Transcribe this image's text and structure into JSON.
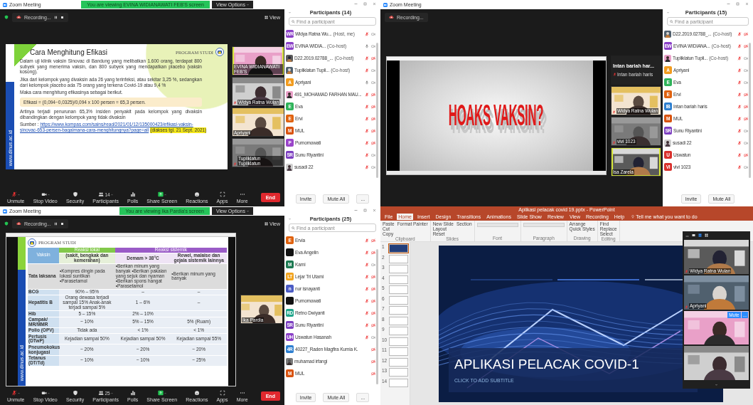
{
  "quadrants": [
    {
      "kind": "zoom",
      "window_title": "Zoom Meeting",
      "banner": "You are viewing EVINA WIDIANAWATI FEB'S screen",
      "view_options": "View Options",
      "recording": "Recording...",
      "record_controls": true,
      "view_button": "View",
      "shared": {
        "kind": "text_slide",
        "title": "Cara Menghitung Efikasi",
        "logo": "PROGRAM STUDI",
        "side_text": "www.dinus.ac.id",
        "paragraphs": [
          "Dalam uji klinik vaksin Sinovac di Bandung yang melibatkan 1.600 orang, terdapat 800 subyek yang menerima vaksin, dan 800 subyek yang mendapatkan placebo (vaksin kosong).",
          "Jika dari kelompok yang divaksin ada 26 yang terinfeksi, atau sekitar 3,25 %, sedangkan dari kelompok placebo ada 75 orang yang terkena Covid-19 atau 9,4 %",
          "Maka cara menghitung efikasinya sebagai berikut."
        ],
        "formula": "Efikasi = (0,094−0,0325)/0,094 x 100 persen = 65,3 persen.",
        "conclusion": "Artinya terjadi penurunan 65,3% insiden penyakit pada kelompok yang divaksin dibandingkan dengan kelompok yang tidak divaksin",
        "source": {
          "label": "Sumber :",
          "url_lines": [
            "https://www.kompas.com/sains/read/2021/01/12/135000423/efikasi-vaksin-",
            "sinovac-653-persen-bagaimana-cara-menghitungnya?page=all"
          ],
          "accessed": "(diakses tgl. 21 Sept. 2021)"
        }
      },
      "gallery": [
        {
          "kind": "video",
          "name": "EVINA WIDIANAWATI FEB'S",
          "muted": false,
          "speaking": true
        },
        {
          "kind": "video",
          "name": "Widya Ratna Wulan",
          "muted": true,
          "speaking": false
        },
        {
          "kind": "video",
          "name": "Apriyani",
          "muted": false,
          "speaking": false
        },
        {
          "kind": "video",
          "name": "Tupliklatun Tupliklatun",
          "muted": true,
          "speaking": false
        }
      ],
      "toolbar": [
        {
          "kind": "mic",
          "label": "Unmute",
          "caret": true
        },
        {
          "kind": "camera",
          "label": "Stop Video",
          "caret": true
        },
        {
          "kind": "security",
          "label": "Security",
          "caret": false
        },
        {
          "kind": "participants",
          "label": "Participants",
          "caret": true,
          "count": "14"
        },
        {
          "kind": "polls",
          "label": "Polls",
          "caret": false
        },
        {
          "kind": "share",
          "label": "Share Screen",
          "caret": true
        },
        {
          "kind": "reactions",
          "label": "Reactions",
          "caret": false
        },
        {
          "kind": "apps",
          "label": "Apps",
          "caret": false
        },
        {
          "kind": "more",
          "label": "More",
          "caret": false
        }
      ],
      "end_button": "End",
      "participants": {
        "title": "Participants (14)",
        "placeholder": "Find a participant",
        "buttons": [
          "Invite",
          "Mute All",
          "..."
        ],
        "rows": [
          {
            "kind": "initials",
            "initials": "WR",
            "color": "#8a3fc7",
            "name": "Widya Ratna Wu...",
            "role": "(Host, me)",
            "muted": true,
            "video_off": false
          },
          {
            "kind": "initials",
            "initials": "EW",
            "color": "#8a3fc7",
            "name": "EVINA WIDIA...",
            "role": "(Co-host)",
            "muted": false,
            "video_off": false
          },
          {
            "name": "D22.2019.02788_...",
            "role": "(Co-host)",
            "muted": true,
            "video_off": true
          },
          {
            "name": "Tupliklatun Tupli...",
            "role": "(Co-host)",
            "muted": true,
            "video_off": false
          },
          {
            "kind": "initials",
            "initials": "A",
            "color": "#f29c1f",
            "name": "Apriyani",
            "muted": false,
            "video_off": false
          },
          {
            "name": "491_MOHAMAD FARHAN MAU...",
            "muted": true,
            "video_off": true
          },
          {
            "kind": "initials",
            "initials": "E",
            "color": "#2fb35a",
            "name": "Eva",
            "muted": true,
            "video_off": true
          },
          {
            "kind": "initials",
            "initials": "E",
            "color": "#e0620f",
            "name": "Ervi",
            "muted": true,
            "video_off": true
          },
          {
            "kind": "initials",
            "initials": "M",
            "color": "#d9530f",
            "name": "MUL",
            "muted": true,
            "video_off": true
          },
          {
            "kind": "initials",
            "initials": "P",
            "color": "#9a45c9",
            "name": "Purnomowati",
            "muted": true,
            "video_off": true
          },
          {
            "kind": "initials",
            "initials": "SR",
            "color": "#7c3fc0",
            "name": "Sunu Riyantini",
            "muted": true,
            "video_off": false
          },
          {
            "name": "susadi 22",
            "muted": true,
            "video_off": false
          }
        ]
      }
    },
    {
      "kind": "zoom",
      "window_title": "Zoom Meeting",
      "recording": "Recording...",
      "record_controls": false,
      "shared": {
        "kind": "video_player",
        "heading": "HOAKS VAKSIN?"
      },
      "gallery": [
        {
          "kind": "name",
          "display": "Intan bariah har...",
          "name": "Intan bariah haris",
          "muted": true,
          "speaking": false
        },
        {
          "kind": "video",
          "name": "Widya Ratna Wulan",
          "muted": true,
          "speaking": false
        },
        {
          "kind": "video",
          "name": "vivi 1023",
          "muted": true,
          "speaking": false
        },
        {
          "kind": "video",
          "name": "Isa Zarela",
          "muted": false,
          "speaking": true
        }
      ],
      "participants": {
        "title": "Participants (15)",
        "placeholder": "Find a participant",
        "buttons": [
          "Invite",
          "Mute All"
        ],
        "rows": [
          {
            "name": "D22.2019.02788_...",
            "role": "(Co-host)",
            "muted": true,
            "video_off": true
          },
          {
            "kind": "initials",
            "initials": "EW",
            "color": "#8a3fc7",
            "name": "EVINA WIDIANA...",
            "role": "(Co-host)",
            "muted": true,
            "video_off": true
          },
          {
            "name": "Tupliklatun Tupli...",
            "role": "(Co-host)",
            "muted": true,
            "video_off": false
          },
          {
            "kind": "initials",
            "initials": "A",
            "color": "#f29c1f",
            "name": "Apriyani",
            "muted": true,
            "video_off": false
          },
          {
            "kind": "initials",
            "initials": "E",
            "color": "#2fb35a",
            "name": "Eva",
            "muted": true,
            "video_off": false
          },
          {
            "kind": "initials",
            "initials": "E",
            "color": "#e0620f",
            "name": "Ervi",
            "muted": true,
            "video_off": true
          },
          {
            "kind": "initials",
            "initials": "IB",
            "color": "#2d7fd0",
            "name": "Intan bariah haris",
            "muted": true,
            "video_off": true
          },
          {
            "kind": "initials",
            "initials": "M",
            "color": "#d9530f",
            "name": "MUL",
            "muted": true,
            "video_off": true
          },
          {
            "kind": "initials",
            "initials": "SR",
            "color": "#7c3fc0",
            "name": "Sunu Riyantini",
            "muted": true,
            "video_off": false
          },
          {
            "name": "susadi 22",
            "muted": true,
            "video_off": false
          },
          {
            "kind": "initials",
            "initials": "U",
            "color": "#d9302c",
            "name": "Uswatun",
            "muted": true,
            "video_off": true
          },
          {
            "kind": "initials",
            "initials": "VI",
            "color": "#d9302c",
            "name": "vivi 1023",
            "muted": true,
            "video_off": false
          }
        ]
      }
    },
    {
      "kind": "zoom",
      "window_title": "Zoom Meeting",
      "banner": "You are viewing Ika Pardia's screen",
      "view_options": "View Options",
      "recording": "Recording...",
      "record_controls": true,
      "view_button": "View",
      "shared": {
        "kind": "table_slide",
        "logo": "PROGRAM STUDI",
        "side_text": "www.dinus.ac.id",
        "head": [
          "Vaksin",
          "Reaksi lokal",
          "Reaksi sistemik"
        ],
        "subhead": [
          "(sakit, bengkak dan kemerahan)",
          "Demam > 38°C",
          "Rewel, malaise dan gejala sistemik lainnya"
        ],
        "rows": [
          [
            "Tata laksana",
            "•Kompres dingin pada lokasi suntikan •Parasetamol",
            "•Berikan minum yang banyak •Berikan pakaian yang sejuk dan nyaman •Berikan spons hangat •Parasetamol",
            "•Berikan minum yang banyak"
          ],
          [
            "BCG",
            "90% – 95%",
            "–",
            "–"
          ],
          [
            "Hepatitis B",
            "Orang dewasa terjadi sampai 15% Anak-anak terjadi sampai 5%",
            "1 – 6%",
            "–"
          ],
          [
            "Hib",
            "5 – 15%",
            "2% – 10%",
            ""
          ],
          [
            "Campak/ MR/MMR",
            "~ 10%",
            "5% – 15%",
            "5% (Ruam)"
          ],
          [
            "Polio (OPV)",
            "Tidak ada",
            "< 1%",
            "< 1%"
          ],
          [
            "Pertusis (DTwP)",
            "Kejadian sampai 50%",
            "Kejadian sampai 50%",
            "Kejadian sampai 55%"
          ],
          [
            "Pneumokokus konjugasi",
            "~ 20%",
            "~ 20%",
            "~ 20%"
          ],
          [
            "Tetanus (DT/Td)",
            "~ 10%",
            "~ 10%",
            "~ 25%"
          ]
        ]
      },
      "gallery": [
        {
          "kind": "video",
          "name": "Ika Pardia",
          "muted": false,
          "speaking": false
        }
      ],
      "toolbar": [
        {
          "kind": "mic",
          "label": "Unmute",
          "caret": true
        },
        {
          "kind": "camera",
          "label": "Stop Video",
          "caret": true
        },
        {
          "kind": "security",
          "label": "Security",
          "caret": false
        },
        {
          "kind": "participants",
          "label": "Participants",
          "caret": true,
          "count": "25"
        },
        {
          "kind": "polls",
          "label": "Polls",
          "caret": false
        },
        {
          "kind": "share",
          "label": "Share Screen",
          "caret": true
        },
        {
          "kind": "reactions",
          "label": "Reactions",
          "caret": false
        },
        {
          "kind": "apps",
          "label": "Apps",
          "caret": false
        },
        {
          "kind": "more",
          "label": "More",
          "caret": false
        }
      ],
      "end_button": "End",
      "participants": {
        "title": "Participants (25)",
        "placeholder": "Find a participant",
        "buttons": [
          "Invite",
          "Mute All",
          "..."
        ],
        "rows": [
          {
            "kind": "initials",
            "initials": "E",
            "color": "#e0620f",
            "name": "Ervia",
            "muted": true,
            "video_off": true
          },
          {
            "kind": "initials",
            "color": "#111111",
            "name": "Eva Angelin",
            "muted": true,
            "video_off": true
          },
          {
            "kind": "initials",
            "initials": "M",
            "color": "#1d7a52",
            "name": "Karni",
            "muted": true,
            "video_off": false
          },
          {
            "kind": "initials",
            "initials": "LT",
            "color": "#f2a41f",
            "name": "Lejar Tri Utami",
            "muted": true,
            "video_off": true
          },
          {
            "kind": "initials",
            "initials": "n",
            "color": "#4b5bc4",
            "name": "nur isnayanti",
            "muted": true,
            "video_off": true
          },
          {
            "kind": "initials",
            "color": "#111111",
            "name": "Purnomowati",
            "muted": true,
            "video_off": true
          },
          {
            "kind": "initials",
            "initials": "RD",
            "color": "#1fa58a",
            "name": "Retno Dwiyanti",
            "muted": true,
            "video_off": true
          },
          {
            "kind": "initials",
            "initials": "SR",
            "color": "#7c3fc0",
            "name": "Sunu Riyantini",
            "muted": true,
            "video_off": true
          },
          {
            "kind": "initials",
            "initials": "UH",
            "color": "#8a3fc7",
            "name": "Uswatun Hasanah",
            "muted": true,
            "video_off": false
          },
          {
            "kind": "initials",
            "initials": "4R",
            "color": "#2d7fd0",
            "name": "40227_Raden Magfira Kurnia K.",
            "video_off": true
          },
          {
            "name": "muhamad irfangi",
            "video_off": true
          },
          {
            "kind": "initials",
            "initials": "M",
            "color": "#d9530f",
            "name": "MUL",
            "video_off": true
          }
        ]
      }
    },
    {
      "kind": "powerpoint",
      "title": "Aplikasi pelacak covid 19.pptx - PowerPoint",
      "tabs": [
        {
          "label": "File",
          "selected": false
        },
        {
          "label": "Home",
          "selected": true
        },
        {
          "label": "Insert",
          "selected": false
        },
        {
          "label": "Design",
          "selected": false
        },
        {
          "label": "Transitions",
          "selected": false
        },
        {
          "label": "Animations",
          "selected": false
        },
        {
          "label": "Slide Show",
          "selected": false
        },
        {
          "label": "Review",
          "selected": false
        },
        {
          "label": "View",
          "selected": false
        },
        {
          "label": "Recording",
          "selected": false
        },
        {
          "label": "Help",
          "selected": false
        }
      ],
      "tell_me": "Tell me what you want to do",
      "ribbon": [
        {
          "label": "Clipboard",
          "buttons": [
            "Paste",
            "Cut",
            "Copy",
            "Format Painter"
          ]
        },
        {
          "label": "Slides",
          "buttons": [
            "New Slide",
            "Layout",
            "Reset",
            "Section"
          ]
        },
        {
          "label": "Font"
        },
        {
          "label": "Paragraph"
        },
        {
          "label": "Drawing",
          "buttons": [
            "Arrange",
            "Quick Styles"
          ]
        },
        {
          "label": "Editing",
          "buttons": [
            "Find",
            "Replace",
            "Select"
          ]
        }
      ],
      "thumbnails": [
        {
          "number": "1",
          "selected": true
        },
        {
          "number": "2",
          "selected": false
        },
        {
          "number": "3",
          "selected": false
        },
        {
          "number": "4",
          "selected": false
        },
        {
          "number": "5",
          "selected": false
        },
        {
          "number": "6",
          "selected": false
        },
        {
          "number": "7",
          "selected": false
        },
        {
          "number": "8",
          "selected": false
        },
        {
          "number": "9",
          "selected": false
        },
        {
          "number": "10",
          "selected": false
        },
        {
          "number": "11",
          "selected": false
        },
        {
          "number": "12",
          "selected": false
        },
        {
          "number": "13",
          "selected": false
        },
        {
          "number": "14",
          "selected": false
        }
      ],
      "slide": {
        "title": "APLIKASI PELACAK COVID-1",
        "subtitle": "CLICK TO ADD SUBTITLE"
      },
      "video_panel": [
        {
          "kind": "video",
          "name": "Widya Ratna Wulan",
          "muted": true
        },
        {
          "kind": "video",
          "name": "Apriyani",
          "muted": true
        },
        {
          "kind": "video",
          "buttons": [
            "Mute",
            "..."
          ]
        },
        {
          "kind": "video"
        }
      ]
    }
  ]
}
